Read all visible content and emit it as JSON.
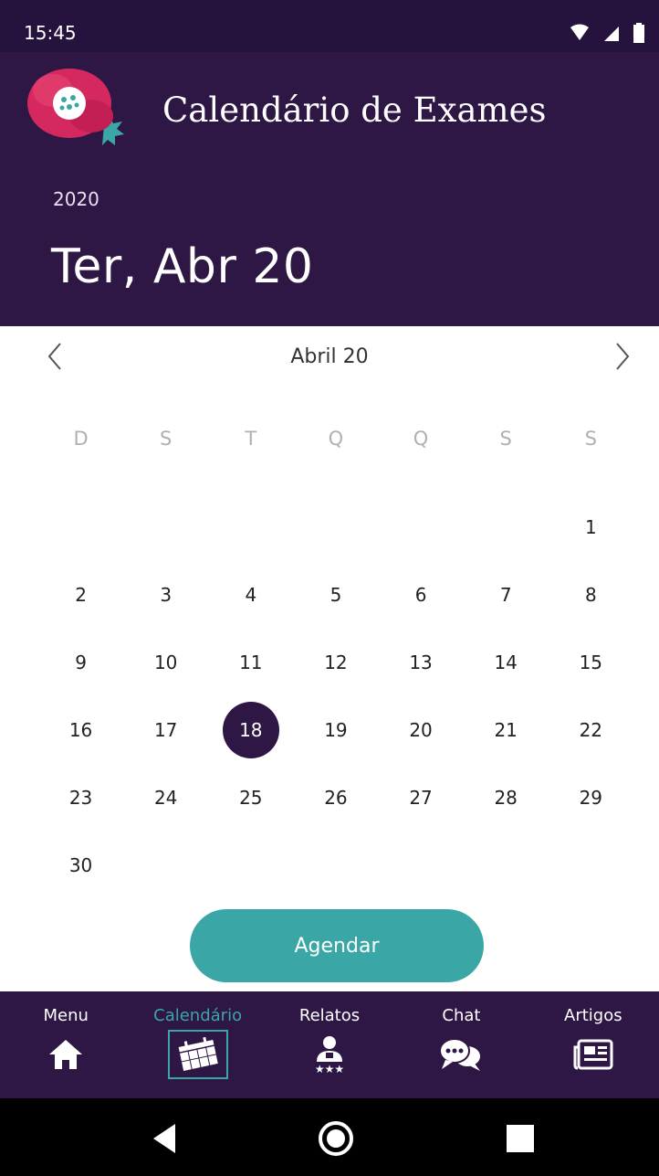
{
  "status_bar": {
    "time": "15:45"
  },
  "header": {
    "app_title": "Calendário de Exames",
    "year": "2020",
    "selected_date": "Ter, Abr 20"
  },
  "calendar": {
    "month_label": "Abril 20",
    "weekdays": [
      "D",
      "S",
      "T",
      "Q",
      "Q",
      "S",
      "S"
    ],
    "weeks": [
      [
        "",
        "",
        "",
        "",
        "",
        "",
        "1"
      ],
      [
        "2",
        "3",
        "4",
        "5",
        "6",
        "7",
        "8"
      ],
      [
        "9",
        "10",
        "11",
        "12",
        "13",
        "14",
        "15"
      ],
      [
        "16",
        "17",
        "18",
        "19",
        "20",
        "21",
        "22"
      ],
      [
        "23",
        "24",
        "25",
        "26",
        "27",
        "28",
        "29"
      ],
      [
        "30",
        "",
        "",
        "",
        "",
        "",
        ""
      ]
    ],
    "selected_day": "18"
  },
  "actions": {
    "schedule_label": "Agendar"
  },
  "bottom_nav": {
    "items": [
      {
        "label": "Menu",
        "icon": "home-icon"
      },
      {
        "label": "Calendário",
        "icon": "calendar-icon"
      },
      {
        "label": "Relatos",
        "icon": "testimonial-icon"
      },
      {
        "label": "Chat",
        "icon": "chat-icon"
      },
      {
        "label": "Artigos",
        "icon": "newspaper-icon"
      }
    ],
    "active_index": 1
  },
  "colors": {
    "header_bg": "#2e1744",
    "accent": "#3aa6a6",
    "logo_flower": "#d4285e"
  }
}
